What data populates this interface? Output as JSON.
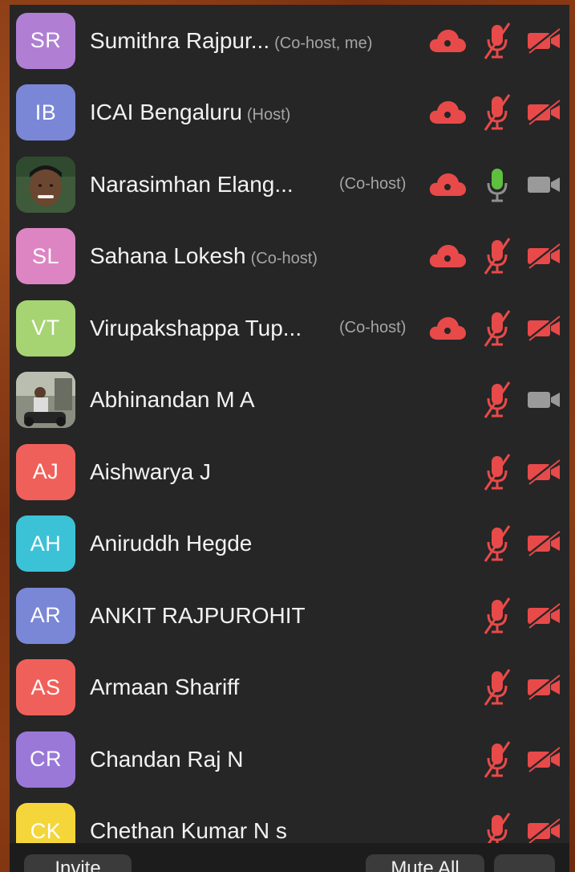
{
  "participants": [
    {
      "initials": "SR",
      "name": "Sumithra Rajpur...",
      "role": "(Co-host, me)",
      "avatar_color": "#b07fd4",
      "photo": false,
      "cloud": true,
      "mic": "muted",
      "video": "off"
    },
    {
      "initials": "IB",
      "name": "ICAI Bengaluru",
      "role": "(Host)",
      "avatar_color": "#7a86d6",
      "photo": false,
      "cloud": true,
      "mic": "muted",
      "video": "off"
    },
    {
      "initials": "",
      "name": "Narasimhan Elang...",
      "role": "(Co-host)",
      "avatar_color": "#3f5a3a",
      "photo": true,
      "cloud": true,
      "mic": "on",
      "video": "on"
    },
    {
      "initials": "SL",
      "name": "Sahana Lokesh",
      "role": "(Co-host)",
      "avatar_color": "#dd85c2",
      "photo": false,
      "cloud": true,
      "mic": "muted",
      "video": "off"
    },
    {
      "initials": "VT",
      "name": "Virupakshappa Tup...",
      "role": "(Co-host)",
      "avatar_color": "#a6d472",
      "photo": false,
      "cloud": true,
      "mic": "muted",
      "video": "off"
    },
    {
      "initials": "",
      "name": "Abhinandan M A",
      "role": "",
      "avatar_color": "#6a6a5e",
      "photo": true,
      "cloud": false,
      "mic": "muted",
      "video": "on"
    },
    {
      "initials": "AJ",
      "name": "Aishwarya J",
      "role": "",
      "avatar_color": "#f0605a",
      "photo": false,
      "cloud": false,
      "mic": "muted",
      "video": "off"
    },
    {
      "initials": "AH",
      "name": "Aniruddh Hegde",
      "role": "",
      "avatar_color": "#3cc2d6",
      "photo": false,
      "cloud": false,
      "mic": "muted",
      "video": "off"
    },
    {
      "initials": "AR",
      "name": "ANKIT RAJPUROHIT",
      "role": "",
      "avatar_color": "#7a86d6",
      "photo": false,
      "cloud": false,
      "mic": "muted",
      "video": "off"
    },
    {
      "initials": "AS",
      "name": "Armaan Shariff",
      "role": "",
      "avatar_color": "#f0605a",
      "photo": false,
      "cloud": false,
      "mic": "muted",
      "video": "off"
    },
    {
      "initials": "CR",
      "name": "Chandan Raj N",
      "role": "",
      "avatar_color": "#9a78d8",
      "photo": false,
      "cloud": false,
      "mic": "muted",
      "video": "off"
    },
    {
      "initials": "CK",
      "name": "Chethan Kumar N s",
      "role": "",
      "avatar_color": "#f5d63a",
      "photo": false,
      "cloud": false,
      "mic": "muted",
      "video": "off"
    }
  ],
  "colors": {
    "muted_red": "#e84a4a",
    "mic_on_green": "#5fbf3f",
    "camera_on_gray": "#9a9a9a"
  },
  "footer": {
    "invite_label": "Invite",
    "mute_all_label": "Mute All",
    "more_label": "..."
  }
}
